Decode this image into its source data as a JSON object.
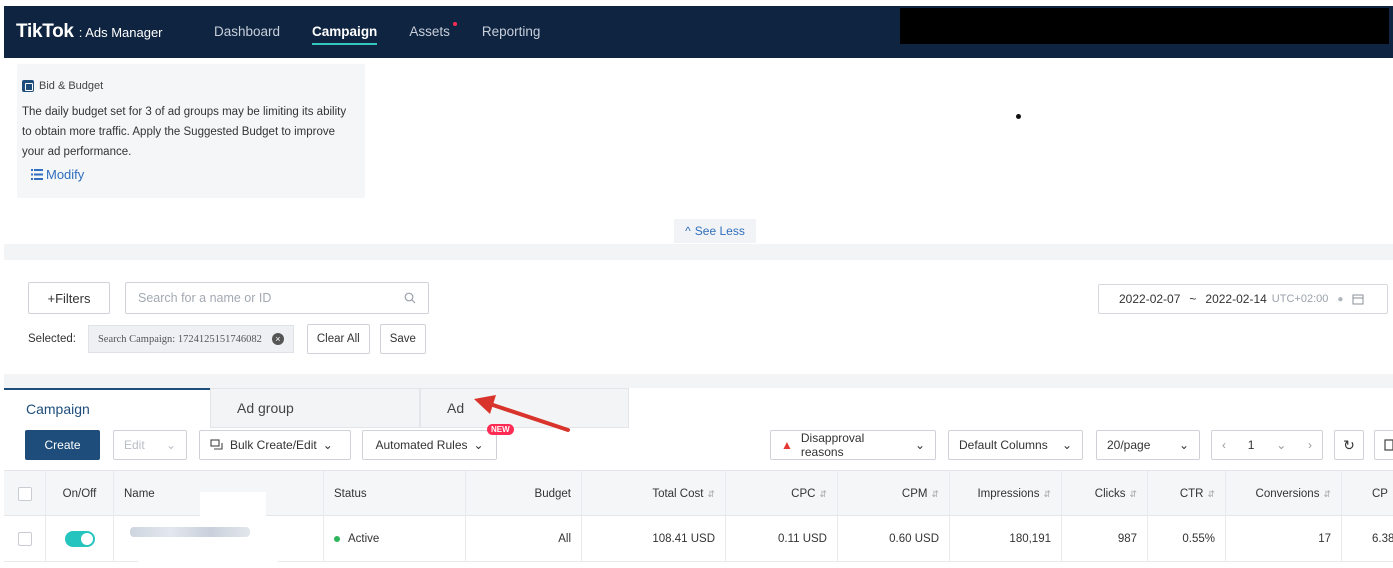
{
  "brand": {
    "logo": "TikTok",
    "product": ": Ads Manager"
  },
  "nav": [
    {
      "label": "Dashboard",
      "active": false
    },
    {
      "label": "Campaign",
      "active": true
    },
    {
      "label": "Assets",
      "active": false
    },
    {
      "label": "Reporting",
      "active": false
    }
  ],
  "recommendation": {
    "icon": "budget-icon",
    "title": "Bid & Budget",
    "text": "The daily budget set for 3 of ad groups may be limiting its ability to obtain more traffic. Apply the Suggested Budget to improve your ad performance.",
    "action": "Modify"
  },
  "see_less": "See Less",
  "filters": {
    "filter_button": "+Filters",
    "search_placeholder": "Search for a name or ID",
    "selected_label": "Selected:",
    "chip": "Search Campaign: 1724125151746082",
    "clear_all": "Clear All",
    "save": "Save"
  },
  "date_range": {
    "start": "2022-02-07",
    "separator": "~",
    "end": "2022-02-14",
    "timezone": "UTC+02:00"
  },
  "tabs": [
    {
      "label": "Campaign",
      "active": true
    },
    {
      "label": "Ad group",
      "active": false
    },
    {
      "label": "Ad",
      "active": false
    }
  ],
  "toolbar": {
    "create": "Create",
    "edit": "Edit",
    "bulk": "Bulk Create/Edit",
    "rules": "Automated Rules",
    "new_badge": "NEW",
    "disapproval": "Disapproval reasons",
    "columns": "Default Columns",
    "per_page": "20/page",
    "page": "1"
  },
  "colors": {
    "nav_bg": "#0f2440",
    "accent": "#33c6c0",
    "primary": "#1e4d7b",
    "toggle": "#25c4bf",
    "alert": "#fe2c55"
  },
  "table": {
    "headers": {
      "onoff": "On/Off",
      "name": "Name",
      "status": "Status",
      "budget": "Budget",
      "total_cost": "Total Cost",
      "cpc": "CPC",
      "cpm": "CPM",
      "impressions": "Impressions",
      "clicks": "Clicks",
      "ctr": "CTR",
      "conversions": "Conversions",
      "cpa": "CP"
    },
    "row": {
      "status": "Active",
      "budget": "All",
      "total_cost": "108.41 USD",
      "cpc": "0.11 USD",
      "cpm": "0.60 USD",
      "impressions": "180,191",
      "clicks": "987",
      "ctr": "0.55%",
      "conversions": "17",
      "cpa": "6.38"
    }
  }
}
